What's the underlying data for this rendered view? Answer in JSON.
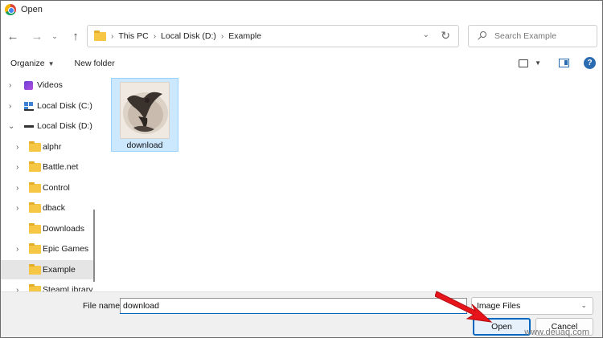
{
  "window": {
    "title": "Open"
  },
  "navigation": {
    "breadcrumb": [
      "This PC",
      "Local Disk (D:)",
      "Example"
    ],
    "search_placeholder": "Search Example"
  },
  "toolbar": {
    "organize_label": "Organize",
    "new_folder_label": "New folder"
  },
  "sidebar": {
    "items": [
      {
        "label": "Videos",
        "icon": "videos-icon",
        "level": 1,
        "chevron": "collapsed"
      },
      {
        "label": "Local Disk (C:)",
        "icon": "drive-icon",
        "level": 1,
        "chevron": "collapsed"
      },
      {
        "label": "Local Disk (D:)",
        "icon": "drive-icon",
        "level": 1,
        "chevron": "expanded"
      },
      {
        "label": "alphr",
        "icon": "folder-icon",
        "level": 2,
        "chevron": "collapsed"
      },
      {
        "label": "Battle.net",
        "icon": "folder-icon",
        "level": 2,
        "chevron": "collapsed"
      },
      {
        "label": "Control",
        "icon": "folder-icon",
        "level": 2,
        "chevron": "collapsed"
      },
      {
        "label": "dback",
        "icon": "folder-icon",
        "level": 2,
        "chevron": "collapsed"
      },
      {
        "label": "Downloads",
        "icon": "folder-icon",
        "level": 2,
        "chevron": "none"
      },
      {
        "label": "Epic Games",
        "icon": "folder-icon",
        "level": 2,
        "chevron": "collapsed"
      },
      {
        "label": "Example",
        "icon": "folder-icon",
        "level": 2,
        "chevron": "none",
        "selected": true
      },
      {
        "label": "SteamLibrary",
        "icon": "folder-icon",
        "level": 2,
        "chevron": "collapsed"
      }
    ]
  },
  "files": [
    {
      "name": "download",
      "selected": true,
      "icon": "image-thumbnail"
    }
  ],
  "footer": {
    "file_name_label": "File name:",
    "file_name_value": "download",
    "file_type": "Image Files",
    "open_label": "Open",
    "cancel_label": "Cancel"
  },
  "watermark": "www.deuaq.com",
  "colors": {
    "accent": "#0067c0",
    "selection": "#cce8ff",
    "annotation_arrow": "#e8141b"
  }
}
